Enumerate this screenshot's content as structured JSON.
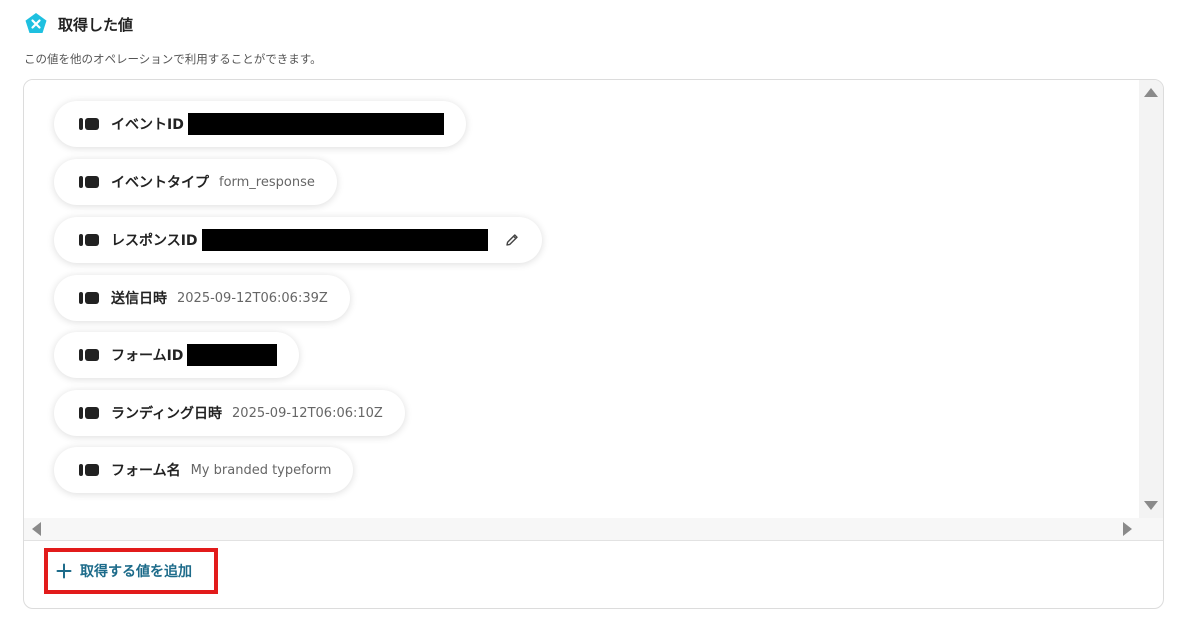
{
  "header": {
    "title": "取得した値",
    "subtitle": "この値を他のオペレーションで利用することができます。",
    "logo_icon": "x-badge-icon"
  },
  "fields": [
    {
      "label": "イベントID",
      "value": "",
      "redacted": true
    },
    {
      "label": "イベントタイプ",
      "value": "form_response",
      "redacted": false
    },
    {
      "label": "レスポンスID",
      "value": "",
      "redacted": true,
      "editable": true
    },
    {
      "label": "送信日時",
      "value": "2025-09-12T06:06:39Z",
      "redacted": false
    },
    {
      "label": "フォームID",
      "value": "",
      "redacted": true
    },
    {
      "label": "ランディング日時",
      "value": "2025-09-12T06:06:10Z",
      "redacted": false
    },
    {
      "label": "フォーム名",
      "value": "My branded typeform",
      "redacted": false
    }
  ],
  "add_button": {
    "label": "取得する値を追加",
    "icon": "plus-icon"
  },
  "colors": {
    "accent": "#1d6b8a",
    "logo": "#1ec0e0",
    "highlight": "#e21b1b"
  }
}
